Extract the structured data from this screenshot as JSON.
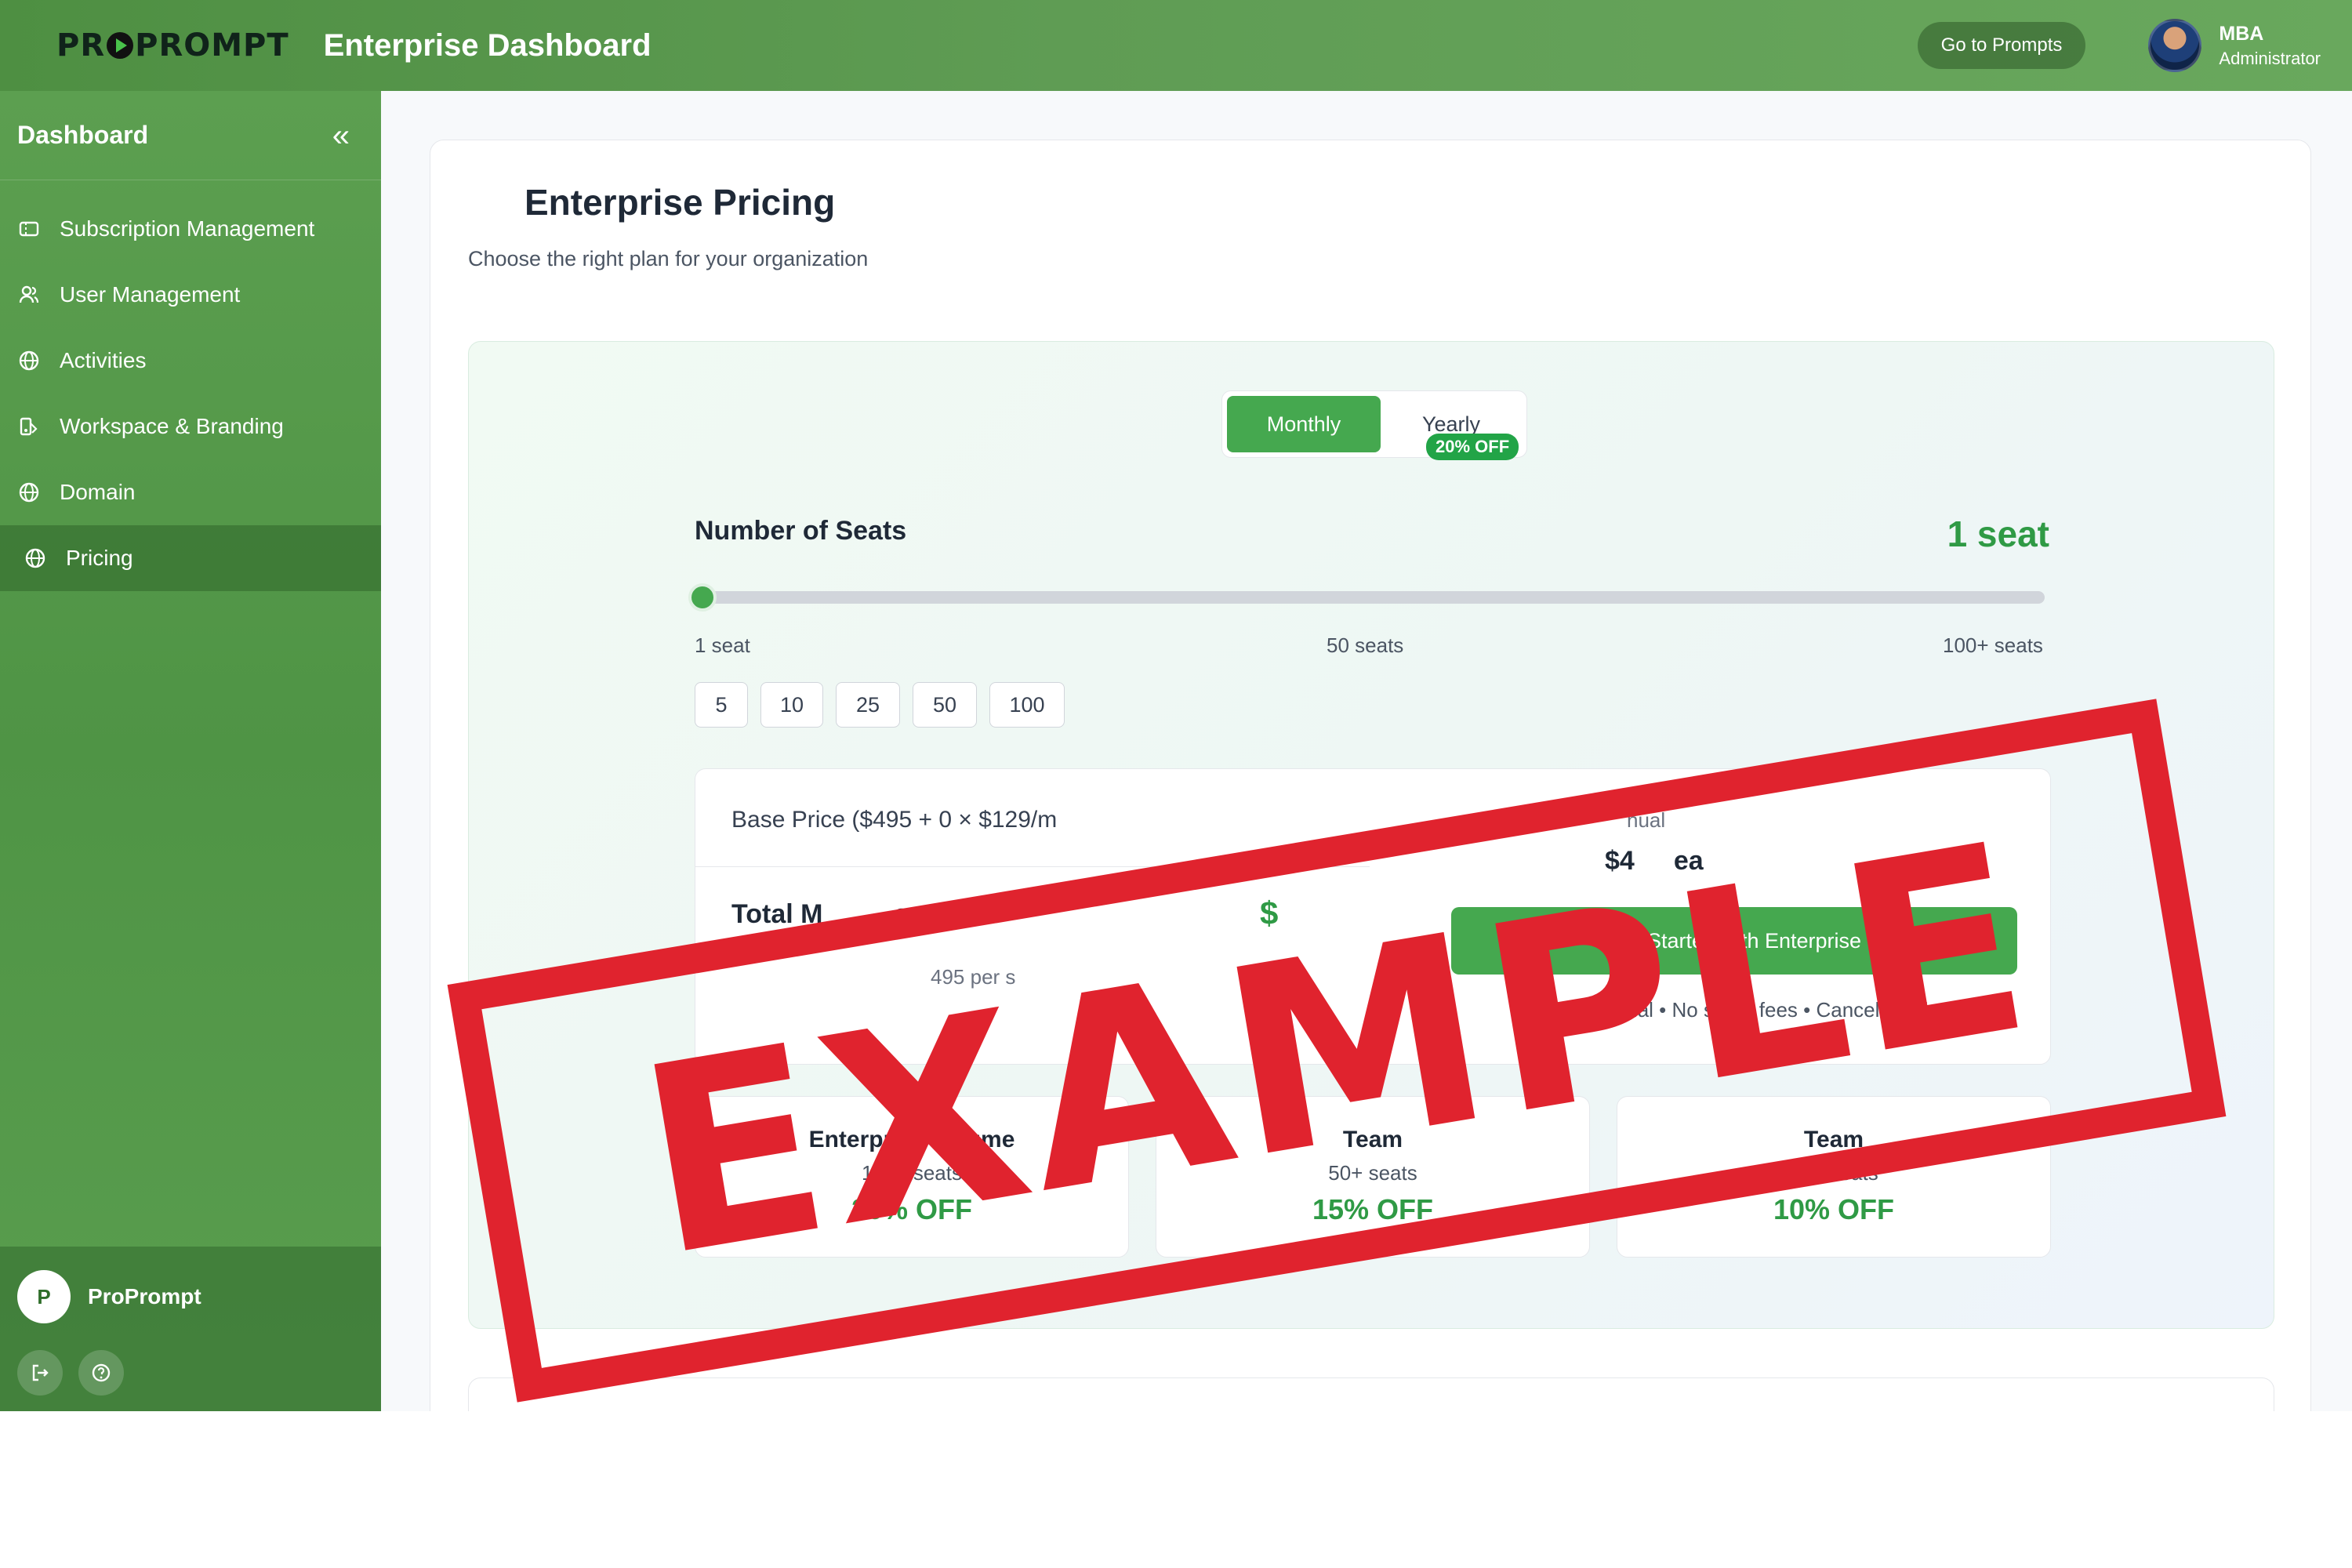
{
  "header": {
    "logo": "PROPROMPT",
    "logo_left": "PR",
    "logo_right": "PROMPT",
    "title": "Enterprise Dashboard",
    "go_prompts_label": "Go to Prompts",
    "user_name": "MBA",
    "user_role": "Administrator"
  },
  "sidebar": {
    "title": "Dashboard",
    "items": [
      {
        "label": "Subscription Management",
        "icon": "ticket-icon"
      },
      {
        "label": "User Management",
        "icon": "users-icon"
      },
      {
        "label": "Activities",
        "icon": "globe-icon"
      },
      {
        "label": "Workspace & Branding",
        "icon": "brush-icon"
      },
      {
        "label": "Domain",
        "icon": "globe-icon"
      },
      {
        "label": "Pricing",
        "icon": "globe-icon",
        "active": true
      }
    ],
    "footer": {
      "brand_initial": "P",
      "brand_name": "ProPrompt"
    }
  },
  "main": {
    "title": "Enterprise Pricing",
    "subtitle": "Choose the right plan for your organization",
    "billing": {
      "monthly_label": "Monthly",
      "yearly_label": "Yearly",
      "yearly_badge": "20% OFF",
      "selected": "Monthly"
    },
    "seats": {
      "label": "Number of Seats",
      "value_text": "1 seat",
      "value": 1,
      "min": 1,
      "max": 100,
      "tick_min": "1 seat",
      "tick_mid": "50 seats",
      "tick_max": "100+ seats",
      "quick_options": [
        "5",
        "10",
        "25",
        "50",
        "100"
      ]
    },
    "summary": {
      "base_price": "Base Price ($495 + 0 × $129/m",
      "total_label": "Total M",
      "total_label_end": "ost",
      "total_value": "$",
      "per_seat": "495 per s",
      "annual_label": "nual",
      "annual_value": "ea",
      "annual_value_start": "$4",
      "get_started_label": "Get Started with Enterprise",
      "trial_note": "14-day free trial • No setup fees • Cancel anytime"
    },
    "tiers": [
      {
        "name": "Enterprise Volume",
        "seats": "100+ seats",
        "discount": "20% OFF"
      },
      {
        "name": "Team",
        "seats": "50+ seats",
        "discount": "15% OFF"
      },
      {
        "name": "Team",
        "seats": "10+ seats",
        "discount": "10% OFF"
      }
    ]
  },
  "overlay": {
    "stamp_text": "EXAMPLE",
    "stamp_color": "#e0232e"
  },
  "colors": {
    "brand_green": "#45a84f",
    "accent_text_green": "#2f9a45"
  }
}
